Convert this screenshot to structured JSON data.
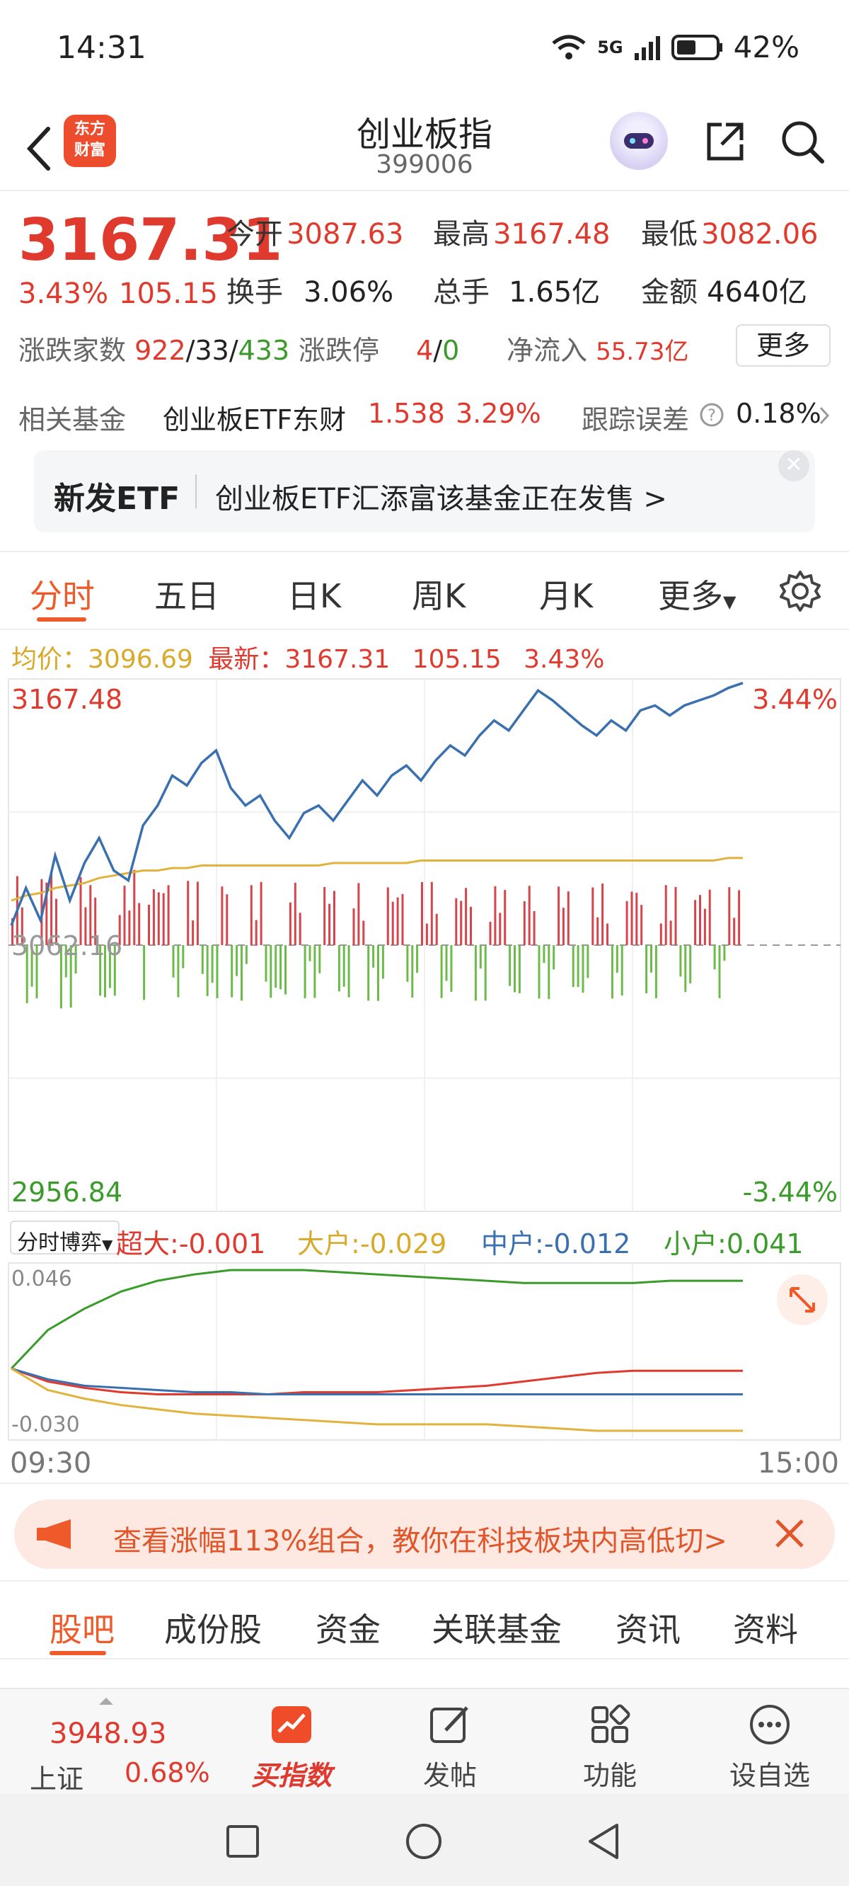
{
  "status": {
    "time": "14:31",
    "network": "5G",
    "battery": "42%"
  },
  "header": {
    "title": "创业板指",
    "code": "399006",
    "logo_text_1": "东方",
    "logo_text_2": "财富"
  },
  "quote": {
    "price": "3167.31",
    "change_pct": "3.43%",
    "change_val": "105.15",
    "open_label": "今开",
    "open": "3087.63",
    "high_label": "最高",
    "high": "3167.48",
    "low_label": "最低",
    "low": "3082.06",
    "turnover_label": "换手",
    "turnover": "3.06%",
    "volume_label": "总手",
    "volume": "1.65亿",
    "amount_label": "金额",
    "amount": "4640亿",
    "breadth_label": "涨跌家数",
    "breadth_up": "922",
    "breadth_flat": "33",
    "breadth_down": "433",
    "limit_label": "涨跌停",
    "limit_up": "4",
    "limit_down": "0",
    "netflow_label": "净流入",
    "netflow": "55.73亿",
    "more_label": "更多"
  },
  "fund": {
    "label": "相关基金",
    "name": "创业板ETF东财",
    "price": "1.538",
    "pct": "3.29%",
    "track_label": "跟踪误差",
    "track_value": "0.18%"
  },
  "etf_banner": {
    "title": "新发ETF",
    "text": "创业板ETF汇添富该基金正在发售  >"
  },
  "chart_tabs": [
    "分时",
    "五日",
    "日K",
    "周K",
    "月K",
    "更多"
  ],
  "price_info": {
    "avg_label": "均价：",
    "avg": "3096.69",
    "latest_label": "最新：",
    "latest": "3167.31",
    "change": "105.15",
    "pct": "3.43%"
  },
  "chart_labels": {
    "top_price": "3167.48",
    "top_pct": "3.44%",
    "mid_price": "3062.16",
    "bottom_price": "2956.84",
    "bottom_pct": "-3.44%"
  },
  "flow": {
    "selector": "分时博弈",
    "super_label": "超大:",
    "super": "-0.001",
    "big_label": "大户:",
    "big": "-0.029",
    "mid_label": "中户:",
    "mid": "-0.012",
    "small_label": "小户:",
    "small": "0.041",
    "max_label": "0.046",
    "min_label": "-0.030"
  },
  "time_axis": {
    "start": "09:30",
    "end": "15:00"
  },
  "promo": {
    "text": "查看涨幅113%组合，教你在科技板块内高低切>"
  },
  "bottom_tabs": [
    "股吧",
    "成份股",
    "资金",
    "关联基金",
    "资讯",
    "资料"
  ],
  "bottom_nav": {
    "index_value": "3948.93",
    "index_name": "上证",
    "index_pct": "0.68%",
    "buy_label": "买指数",
    "post_label": "发帖",
    "func_label": "功能",
    "watch_label": "设自选"
  },
  "colors": {
    "up": "#e03a2f",
    "down": "#3a9b2b",
    "accent": "#ef5a2a",
    "price_line": "#3a6fb0",
    "avg_line": "#e2b33c"
  },
  "chart_data": [
    {
      "type": "line",
      "title": "",
      "series": [
        {
          "name": "最新",
          "values": [
            3070,
            3085,
            3072,
            3098,
            3080,
            3095,
            3105,
            3092,
            3088,
            3110,
            3118,
            3130,
            3126,
            3135,
            3140,
            3125,
            3118,
            3122,
            3112,
            3105,
            3115,
            3118,
            3112,
            3120,
            3128,
            3122,
            3130,
            3134,
            3128,
            3136,
            3142,
            3138,
            3146,
            3152,
            3148,
            3156,
            3164,
            3160,
            3155,
            3150,
            3146,
            3152,
            3148,
            3156,
            3158,
            3154,
            3158,
            3160,
            3162,
            3165,
            3167
          ]
        },
        {
          "name": "均价",
          "values": [
            3080,
            3082,
            3083,
            3085,
            3086,
            3087,
            3089,
            3090,
            3091,
            3092,
            3092,
            3093,
            3093,
            3094,
            3094,
            3094,
            3094,
            3094,
            3094,
            3094,
            3094,
            3094,
            3095,
            3095,
            3095,
            3095,
            3095,
            3095,
            3096,
            3096,
            3096,
            3096,
            3096,
            3096,
            3096,
            3096,
            3096,
            3096,
            3096,
            3096,
            3096,
            3096,
            3096,
            3096,
            3096,
            3096,
            3096,
            3096,
            3096,
            3097,
            3097
          ]
        }
      ],
      "ylim": [
        2956.84,
        3167.48
      ],
      "reference": 3062.16
    },
    {
      "type": "line",
      "title": "",
      "series": [
        {
          "name": "超大",
          "values": [
            0,
            -0.006,
            -0.009,
            -0.011,
            -0.012,
            -0.012,
            -0.012,
            -0.012,
            -0.011,
            -0.011,
            -0.011,
            -0.01,
            -0.009,
            -0.008,
            -0.006,
            -0.004,
            -0.002,
            -0.001,
            -0.001,
            -0.001,
            -0.001
          ]
        },
        {
          "name": "大户",
          "values": [
            0,
            -0.01,
            -0.014,
            -0.017,
            -0.019,
            -0.021,
            -0.022,
            -0.023,
            -0.024,
            -0.025,
            -0.026,
            -0.026,
            -0.026,
            -0.026,
            -0.027,
            -0.028,
            -0.029,
            -0.029,
            -0.029,
            -0.029,
            -0.029
          ]
        },
        {
          "name": "中户",
          "values": [
            0,
            -0.005,
            -0.008,
            -0.009,
            -0.01,
            -0.011,
            -0.011,
            -0.012,
            -0.012,
            -0.012,
            -0.012,
            -0.012,
            -0.012,
            -0.012,
            -0.012,
            -0.012,
            -0.012,
            -0.012,
            -0.012,
            -0.012,
            -0.012
          ]
        },
        {
          "name": "小户",
          "values": [
            0,
            0.018,
            0.028,
            0.036,
            0.041,
            0.044,
            0.046,
            0.046,
            0.046,
            0.045,
            0.044,
            0.043,
            0.042,
            0.041,
            0.04,
            0.04,
            0.04,
            0.04,
            0.041,
            0.041,
            0.041
          ]
        }
      ],
      "ylim": [
        -0.03,
        0.046
      ]
    }
  ]
}
